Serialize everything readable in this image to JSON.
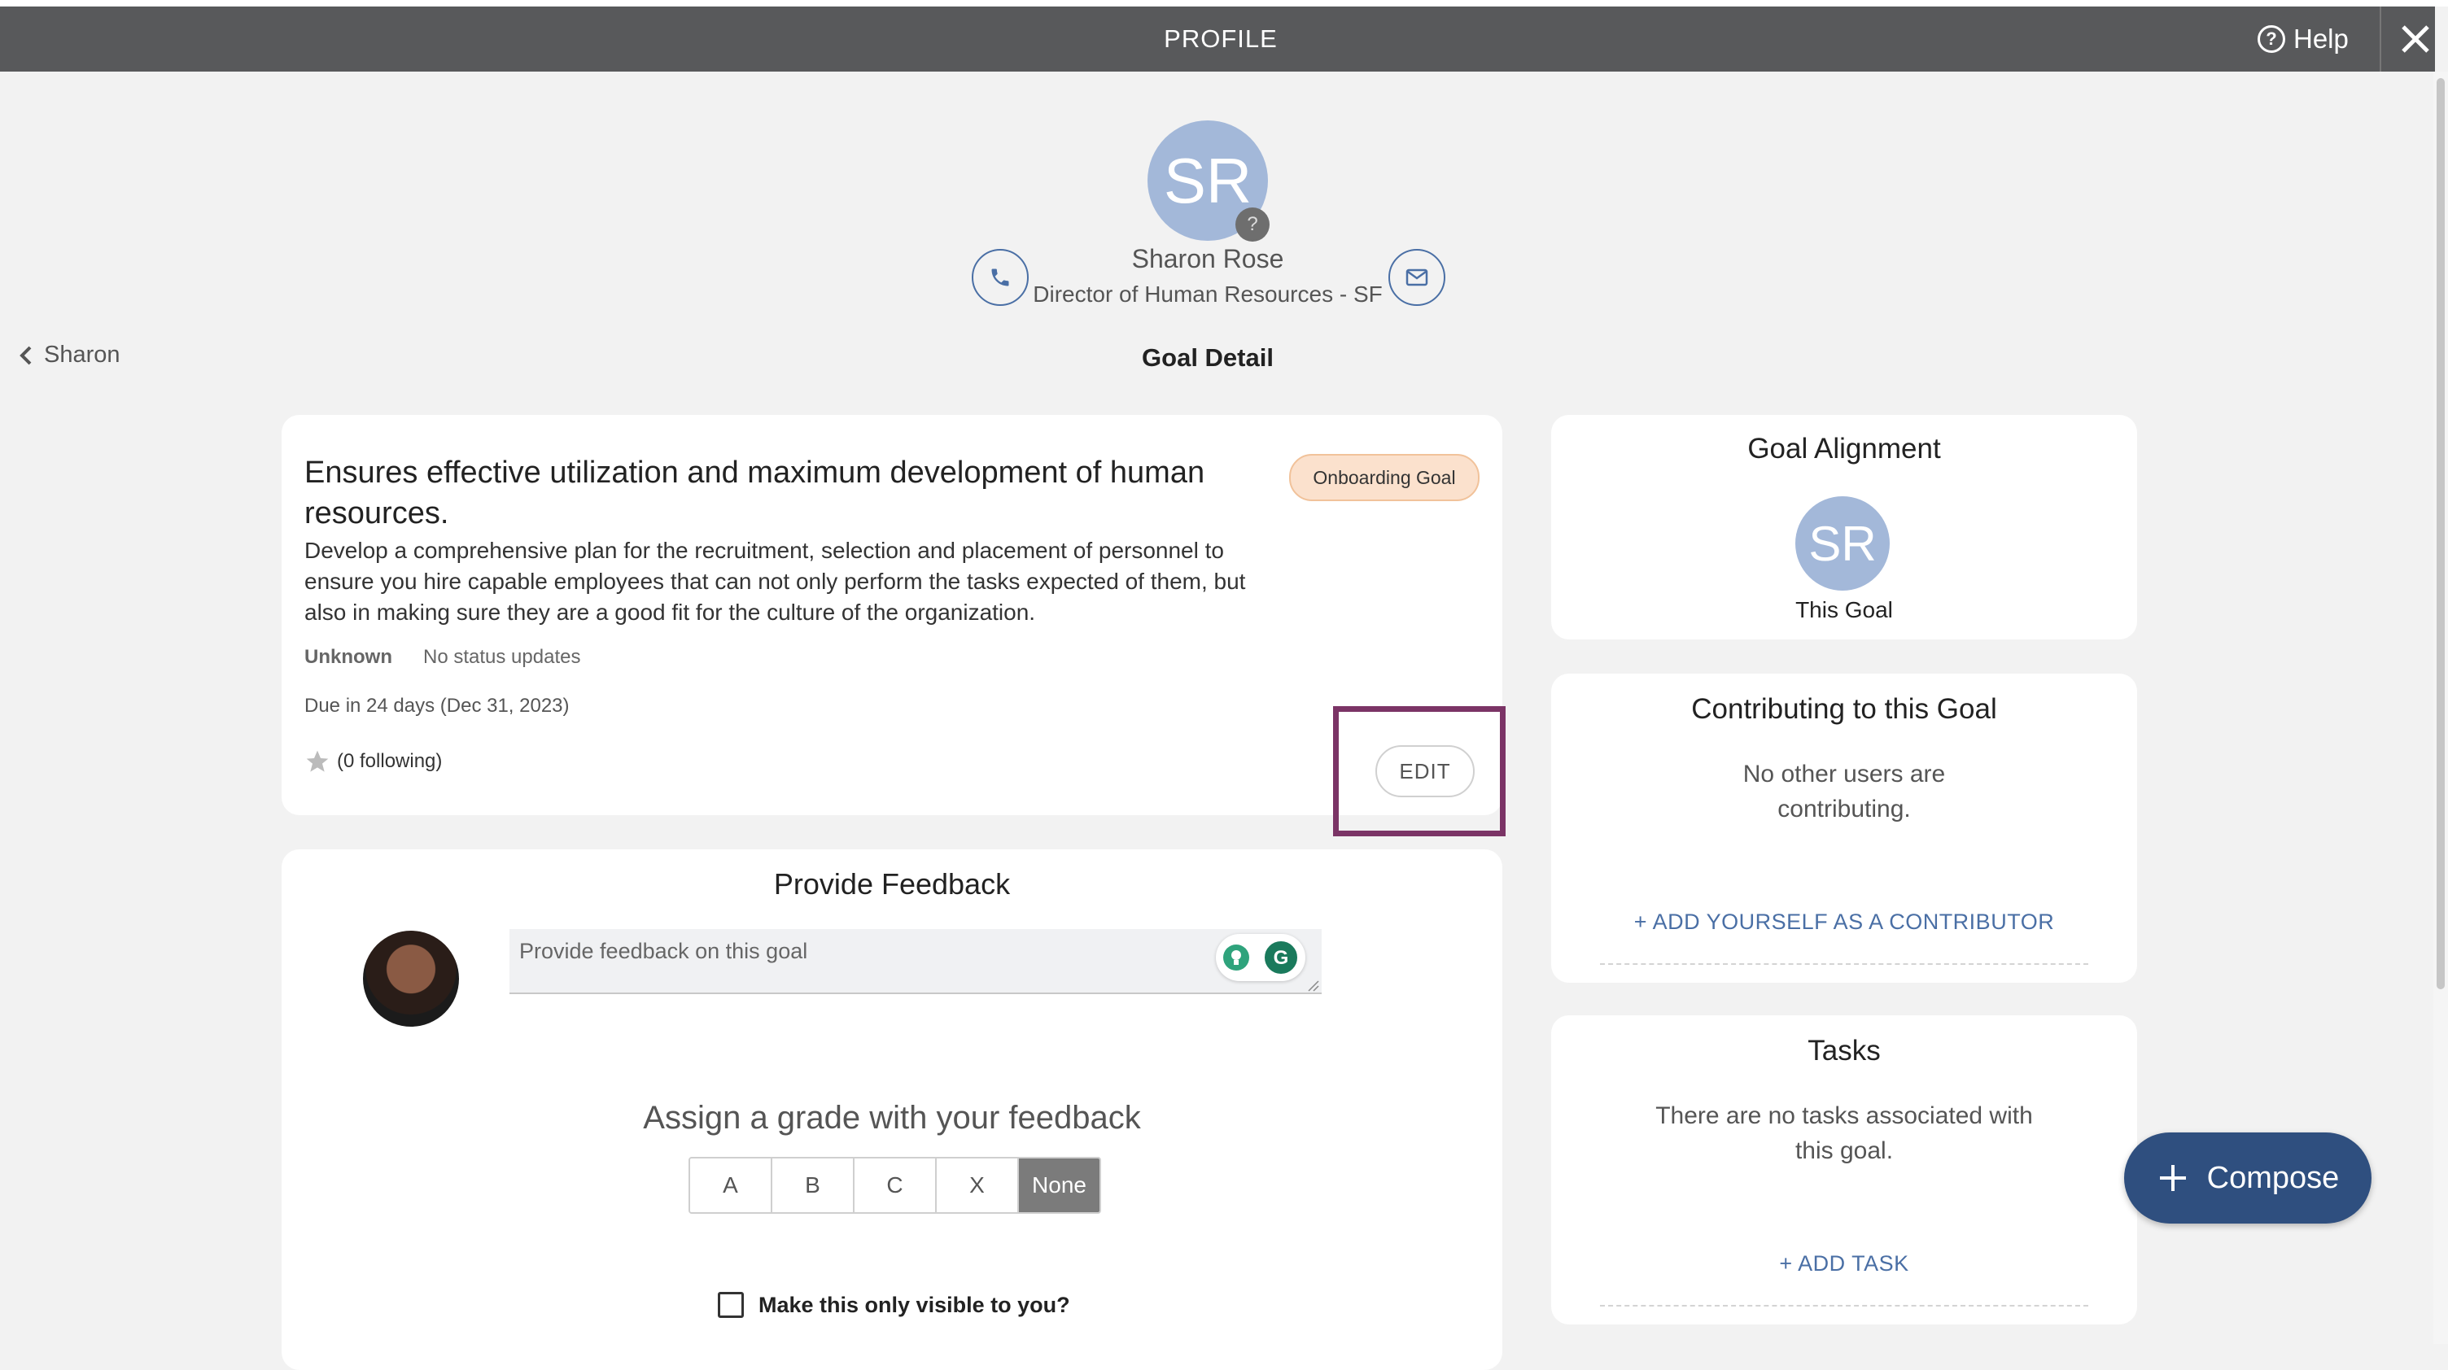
{
  "header": {
    "title": "PROFILE",
    "help_label": "Help",
    "close_icon": "close-icon"
  },
  "profile": {
    "initials": "SR",
    "badge_symbol": "?",
    "name": "Sharon Rose",
    "job_title": "Director of Human Resources - SF",
    "phone_icon": "phone-icon",
    "email_icon": "email-icon"
  },
  "nav": {
    "back_label": "Sharon",
    "page_heading": "Goal Detail"
  },
  "goal": {
    "title": "Ensures effective utilization and maximum development of human resources.",
    "description": "Develop a comprehensive plan for the recruitment, selection and placement of personnel to ensure you hire capable employees that can not only perform the tasks expected of them, but also in making sure they are a good fit for the culture of the organization.",
    "tag": "Onboarding Goal",
    "status": "Unknown",
    "status_updates": "No status updates",
    "due": "Due in 24 days (Dec 31, 2023)",
    "following": "(0 following)",
    "edit_label": "EDIT"
  },
  "feedback": {
    "title": "Provide Feedback",
    "placeholder": "Provide feedback on this goal",
    "grade_title": "Assign a grade with your feedback",
    "grades": [
      "A",
      "B",
      "C",
      "X",
      "None"
    ],
    "selected_grade": "None",
    "visible_label": "Make this only visible to you?"
  },
  "alignment": {
    "title": "Goal Alignment",
    "initials": "SR",
    "label": "This Goal"
  },
  "contributing": {
    "title": "Contributing to this Goal",
    "text": "No other users are contributing.",
    "link": "+ ADD YOURSELF AS A CONTRIBUTOR"
  },
  "tasks": {
    "title": "Tasks",
    "text": "There are no tasks associated with this goal.",
    "link": "+ ADD TASK"
  },
  "compose": {
    "label": "Compose"
  },
  "colors": {
    "header_bg": "#58595b",
    "accent_blue": "#4a6fa5",
    "compose_bg": "#2f4f7f",
    "avatar_bg": "#a3b8d9",
    "badge_bg": "#fbe1cd",
    "highlight_border": "#7b3466"
  }
}
